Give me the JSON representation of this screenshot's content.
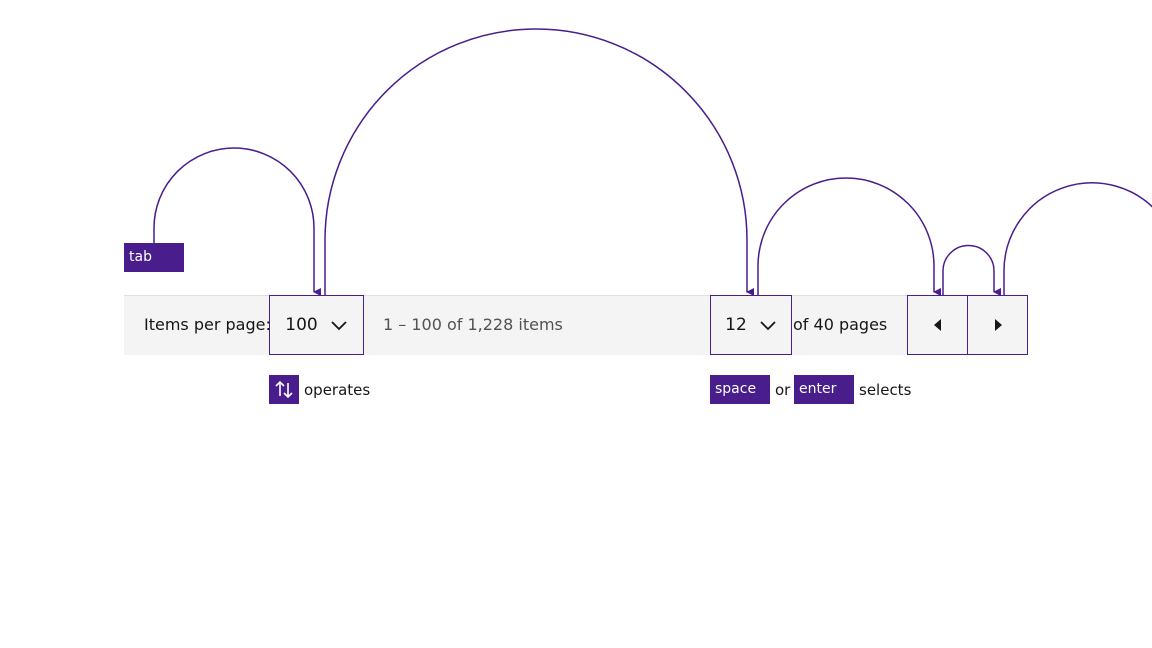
{
  "keys": {
    "tab": "tab",
    "space": "space",
    "or": "or",
    "enter": "enter",
    "operates": "operates",
    "selects": "selects"
  },
  "pagination": {
    "items_per_page_label": "Items per page:",
    "items_per_page_value": "100",
    "range_text": "1 – 100 of 1,228 items",
    "page_value": "12",
    "of_pages_text": "of 40 pages"
  },
  "colors": {
    "accent": "#491d8b",
    "bar_background": "#f4f4f4"
  },
  "icons": {
    "arrows": "up-down-arrows-icon",
    "chevron": "chevron-down-icon",
    "prev": "caret-left-icon",
    "next": "caret-right-icon"
  }
}
